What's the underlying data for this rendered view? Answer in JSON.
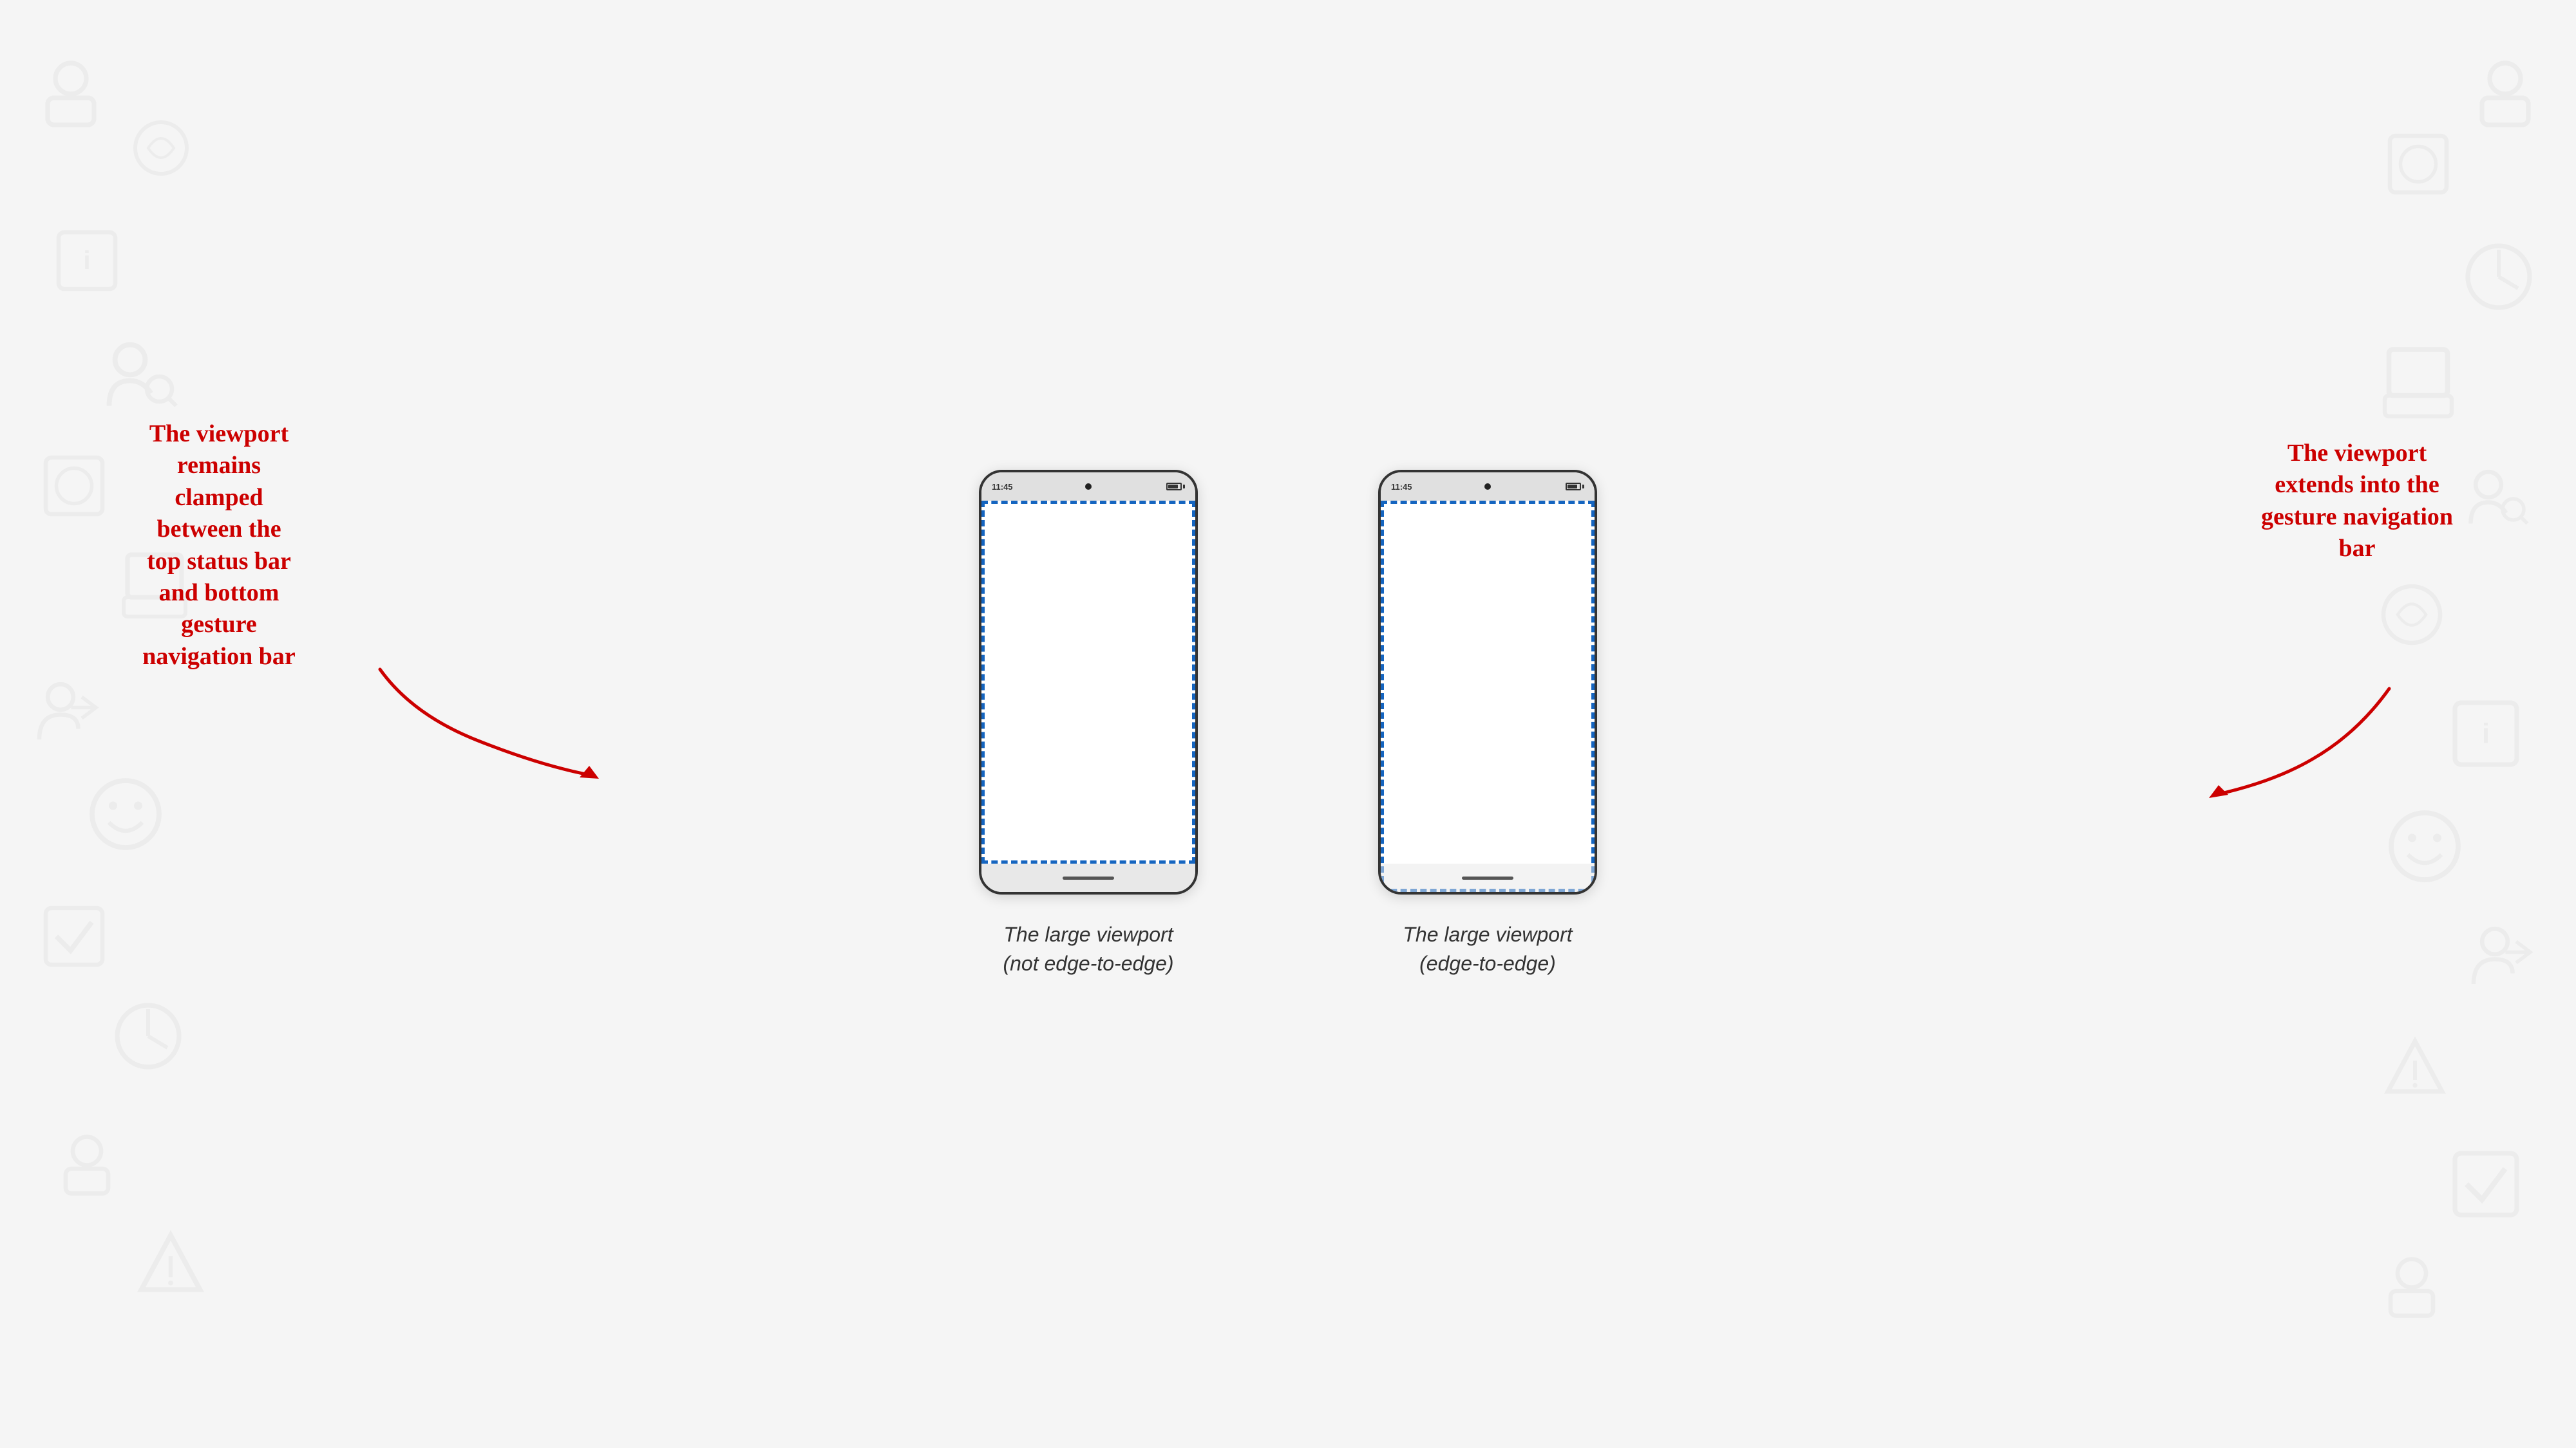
{
  "background": {
    "color": "#f0f0f0"
  },
  "phones": [
    {
      "id": "not-edge",
      "type": "not-edge-to-edge",
      "status_bar": {
        "time": "11:45"
      },
      "caption_line1": "The large viewport",
      "caption_line2": "(not edge-to-edge)"
    },
    {
      "id": "edge",
      "type": "edge-to-edge",
      "status_bar": {
        "time": "11:45"
      },
      "caption_line1": "The large viewport",
      "caption_line2": "(edge-to-edge)"
    }
  ],
  "annotations": {
    "left": {
      "line1": "The viewport",
      "line2": "remains",
      "line3": "clamped",
      "line4": "between the",
      "line5": "top status bar",
      "line6": "and bottom",
      "line7": "gesture",
      "line8": "navigation bar"
    },
    "right": {
      "line1": "The viewport",
      "line2": "extends into the",
      "line3": "gesture navigation",
      "line4": "bar"
    }
  },
  "caption_phone1_line1": "The large viewport",
  "caption_phone1_line2": "(not edge-to-edge)",
  "caption_phone2_line1": "The large viewport",
  "caption_phone2_line2": "(edge-to-edge)"
}
